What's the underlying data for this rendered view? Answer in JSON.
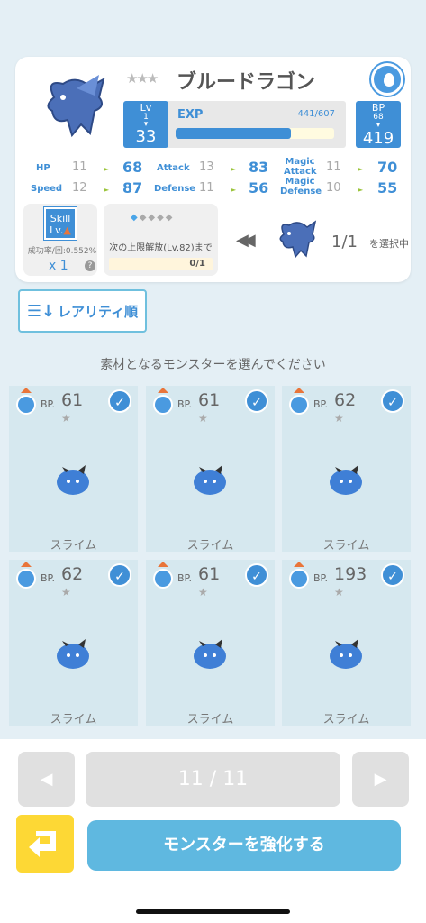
{
  "monster": {
    "stars": "★★★",
    "name": "ブルードラゴン",
    "element_icon": "water-drop-icon",
    "lv_label": "Lv",
    "lv_from": "1",
    "lv_to": "33",
    "exp_label": "EXP",
    "exp_value": "441/607",
    "exp_fraction": 0.727,
    "bp_label": "BP",
    "bp_from": "68",
    "bp_to": "419"
  },
  "stats": [
    {
      "name": "HP",
      "old": "11",
      "new": "68"
    },
    {
      "name": "Attack",
      "old": "13",
      "new": "83"
    },
    {
      "name": "Magic Attack",
      "old": "11",
      "new": "70"
    },
    {
      "name": "Speed",
      "old": "12",
      "new": "87"
    },
    {
      "name": "Defense",
      "old": "11",
      "new": "56"
    },
    {
      "name": "Magic Defense",
      "old": "10",
      "new": "55"
    }
  ],
  "skill": {
    "icon_label_1": "Skill",
    "icon_label_2": "Lv.",
    "rate": "成功率/回:0.552%",
    "count": "x 1"
  },
  "limit": {
    "text": "次の上限解放(Lv.82)まで",
    "value": "0/1"
  },
  "selection": {
    "count": "1/1",
    "label": "を選択中"
  },
  "sort": {
    "label": "レアリティ順"
  },
  "instruction": "素材となるモンスターを選んでください",
  "monsters": [
    {
      "bp_label": "BP.",
      "bp": "61",
      "name": "スライム",
      "checked": true
    },
    {
      "bp_label": "BP.",
      "bp": "61",
      "name": "スライム",
      "checked": true
    },
    {
      "bp_label": "BP.",
      "bp": "62",
      "name": "スライム",
      "checked": true
    },
    {
      "bp_label": "BP.",
      "bp": "62",
      "name": "スライム",
      "checked": true
    },
    {
      "bp_label": "BP.",
      "bp": "61",
      "name": "スライム",
      "checked": true
    },
    {
      "bp_label": "BP.",
      "bp": "193",
      "name": "スライム",
      "checked": true
    }
  ],
  "pagination": {
    "page": "11 / 11",
    "prev_icon": "◀",
    "next_icon": "▶"
  },
  "actions": {
    "enhance_label": "モンスターを強化する",
    "back_icon": "return-arrow-icon"
  },
  "colors": {
    "accent": "#3f8fd6",
    "button": "#5fb8e0",
    "back": "#fdd835",
    "card": "#d6e8ef"
  }
}
